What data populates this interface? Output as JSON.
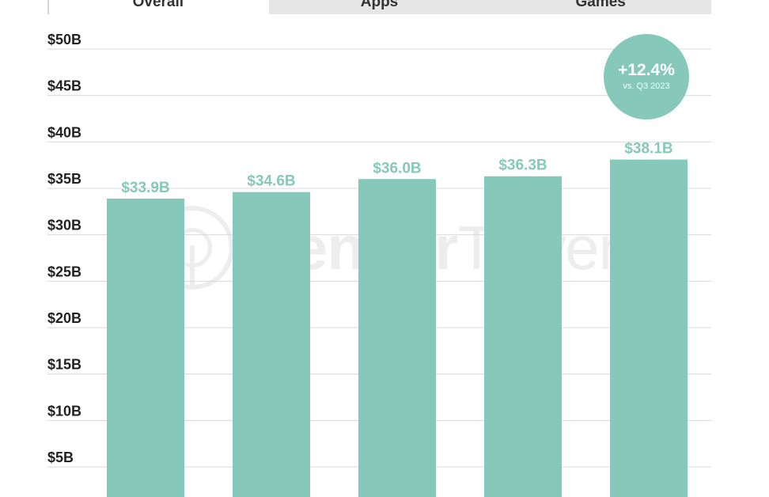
{
  "tabs": [
    {
      "label": "Overall",
      "active": true
    },
    {
      "label": "Apps",
      "active": false
    },
    {
      "label": "Games",
      "active": false
    }
  ],
  "badge": {
    "value": "+12.4%",
    "subtitle": "vs. Q3 2023"
  },
  "watermark": {
    "bold": "Sensor",
    "light": "Tower"
  },
  "colors": {
    "bar": "#86c8b9",
    "label": "#86c8b9",
    "axis_text": "#222222",
    "grid": "#d9d9d9"
  },
  "chart_data": {
    "type": "bar",
    "values": [
      33.9,
      34.6,
      36.0,
      36.3,
      38.1
    ],
    "data_labels": [
      "$33.9B",
      "$34.6B",
      "$36.0B",
      "$36.3B",
      "$38.1B"
    ],
    "y_ticks": [
      5,
      10,
      15,
      20,
      25,
      30,
      35,
      40,
      45,
      50
    ],
    "y_tick_labels": [
      "$5B",
      "$10B",
      "$15B",
      "$20B",
      "$25B",
      "$30B",
      "$35B",
      "$40B",
      "$45B",
      "$50B"
    ],
    "ylim": [
      0,
      50
    ],
    "grid": true
  }
}
